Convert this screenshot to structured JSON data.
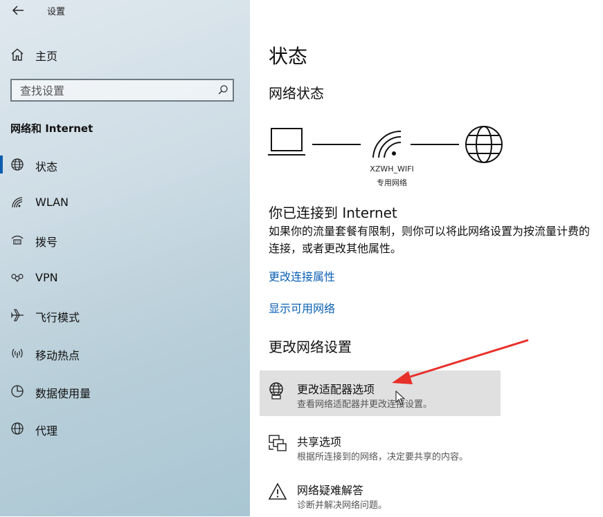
{
  "titlebar": {
    "back_icon": "back-arrow-icon",
    "title": "设置"
  },
  "sidebar": {
    "home": {
      "icon": "home-icon",
      "label": "主页"
    },
    "search": {
      "placeholder": "查找设置",
      "icon": "search-icon"
    },
    "section_title": "网络和 Internet",
    "items": [
      {
        "icon": "globe-icon",
        "label": "状态",
        "active": true
      },
      {
        "icon": "wifi-icon",
        "label": "WLAN"
      },
      {
        "icon": "dialup-icon",
        "label": "拨号"
      },
      {
        "icon": "vpn-icon",
        "label": "VPN"
      },
      {
        "icon": "airplane-icon",
        "label": "飞行模式"
      },
      {
        "icon": "hotspot-icon",
        "label": "移动热点"
      },
      {
        "icon": "data-usage-icon",
        "label": "数据使用量"
      },
      {
        "icon": "proxy-globe-icon",
        "label": "代理"
      }
    ]
  },
  "main": {
    "title": "状态",
    "network_status_heading": "网络状态",
    "network": {
      "name": "XZWH_WIFI",
      "type": "专用网络"
    },
    "connected_title": "你已连接到 Internet",
    "connected_desc": "如果你的流量套餐有限制，则你可以将此网络设置为按流量计费的连接，或者更改其他属性。",
    "links": [
      "更改连接属性",
      "显示可用网络"
    ],
    "change_heading": "更改网络设置",
    "options": [
      {
        "icon": "adapter-globe-icon",
        "title": "更改适配器选项",
        "subtitle": "查看网络适配器并更改连接设置。",
        "highlighted": true
      },
      {
        "icon": "sharing-icon",
        "title": "共享选项",
        "subtitle": "根据所连接到的网络，决定要共享的内容。"
      },
      {
        "icon": "warning-icon",
        "title": "网络疑难解答",
        "subtitle": "诊断并解决网络问题。"
      }
    ]
  },
  "colors": {
    "link": "#0a5fb4",
    "accent": "#0b5cad",
    "annotation_arrow": "#e8302a",
    "hover_bg": "#e0e0e0"
  }
}
